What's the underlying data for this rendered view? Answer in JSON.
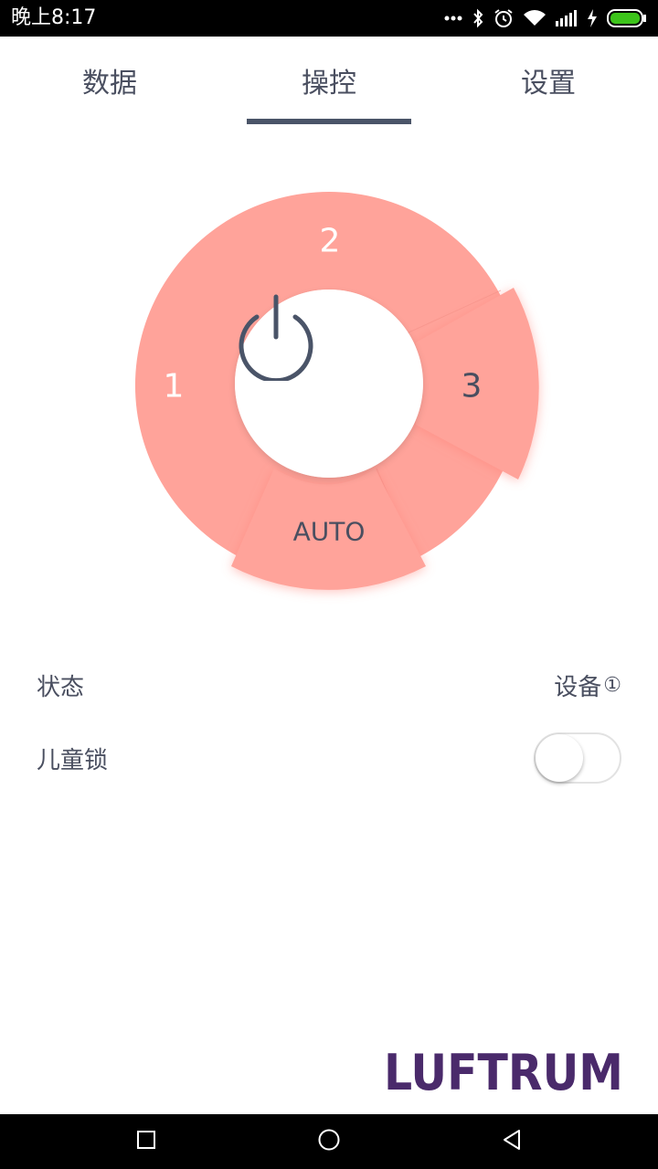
{
  "status_bar": {
    "time": "晚上8:17",
    "icons": [
      "more-dots-icon",
      "bluetooth-icon",
      "alarm-icon",
      "wifi-icon",
      "signal-icon",
      "charging-icon",
      "battery-icon"
    ],
    "battery_color": "#3cc41a"
  },
  "tabs": [
    {
      "label": "数据",
      "active": false
    },
    {
      "label": "操控",
      "active": true
    },
    {
      "label": "设置",
      "active": false
    }
  ],
  "dial": {
    "color": "#ffa39a",
    "selected_segment": "3",
    "segments": {
      "one": "1",
      "two": "2",
      "three": "3",
      "auto": "AUTO"
    },
    "power_icon": "power-icon"
  },
  "rows": {
    "status": {
      "label": "状态",
      "value": "设备",
      "value_suffix": "①"
    },
    "child_lock": {
      "label": "儿童锁",
      "enabled": false
    }
  },
  "logo": {
    "text": "LUFTRUM",
    "color": "#4a2a6b"
  },
  "nav_bar": {
    "icons": [
      "recent-apps-icon",
      "home-icon",
      "back-icon"
    ]
  }
}
